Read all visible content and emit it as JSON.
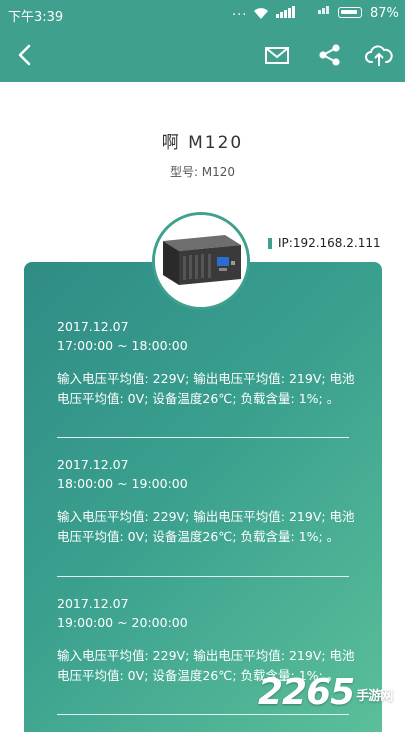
{
  "status_bar": {
    "time": "下午3:39",
    "dots": "...",
    "battery_percent": "87%"
  },
  "app_bar": {
    "back_icon": "back-arrow-icon",
    "mail_icon": "mail-icon",
    "share_icon": "share-icon",
    "upload_icon": "cloud-upload-icon"
  },
  "device": {
    "name": "啊 M120",
    "model": "型号: M120",
    "ip": "IP:192.168.2.111"
  },
  "records": [
    {
      "date": "2017.12.07",
      "time_range": "17:00:00 ~ 18:00:00",
      "data": "输入电压平均值: 229V; 输出电压平均值: 219V; 电池电压平均值: 0V; 设备温度26℃; 负载含量: 1%; 。"
    },
    {
      "date": "2017.12.07",
      "time_range": "18:00:00 ~ 19:00:00",
      "data": "输入电压平均值: 229V; 输出电压平均值: 219V; 电池电压平均值: 0V; 设备温度26℃; 负载含量: 1%; 。"
    },
    {
      "date": "2017.12.07",
      "time_range": "19:00:00 ~ 20:00:00",
      "data": "输入电压平均值: 229V; 输出电压平均值: 219V; 电池电压平均值: 0V; 设备温度26℃; 负载含量: 1%; 。"
    }
  ],
  "watermark": {
    "number": "2265",
    "suffix": "手游网"
  },
  "colors": {
    "primary": "#3ea08d",
    "card_start": "#2f8c86",
    "card_end": "#5bbf9a"
  }
}
